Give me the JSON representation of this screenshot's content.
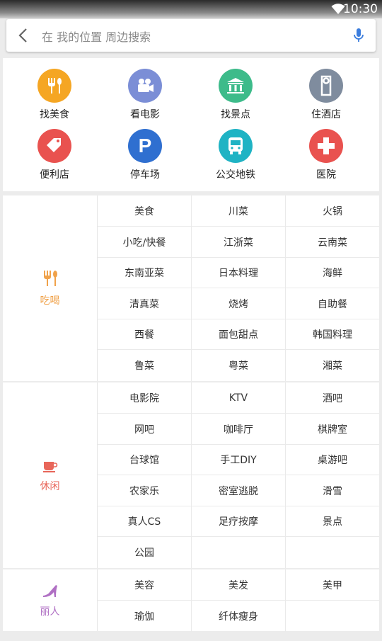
{
  "status": {
    "time": "10:30"
  },
  "search": {
    "placeholder": "在 我的位置 周边搜索"
  },
  "categories": [
    {
      "label": "找美食",
      "icon": "fork-knife-icon",
      "color": "#f5a623"
    },
    {
      "label": "看电影",
      "icon": "movie-camera-icon",
      "color": "#7b8ed6"
    },
    {
      "label": "找景点",
      "icon": "landmark-icon",
      "color": "#3dbb8a"
    },
    {
      "label": "住酒店",
      "icon": "door-tag-icon",
      "color": "#7f8c9e"
    },
    {
      "label": "便利店",
      "icon": "price-tag-icon",
      "color": "#e9524f"
    },
    {
      "label": "停车场",
      "icon": "parking-icon",
      "color": "#2f6fd0"
    },
    {
      "label": "公交地铁",
      "icon": "bus-icon",
      "color": "#1fb3c4"
    },
    {
      "label": "医院",
      "icon": "cross-icon",
      "color": "#e9524f"
    }
  ],
  "sections": [
    {
      "name": "吃喝",
      "icon": "fork-knife-icon",
      "color": "#f0a24a",
      "items": [
        "美食",
        "川菜",
        "火锅",
        "小吃/快餐",
        "江浙菜",
        "云南菜",
        "东南亚菜",
        "日本料理",
        "海鲜",
        "清真菜",
        "烧烤",
        "自助餐",
        "西餐",
        "面包甜点",
        "韩国料理",
        "鲁菜",
        "粤菜",
        "湘菜"
      ]
    },
    {
      "name": "休闲",
      "icon": "cup-icon",
      "color": "#e8665a",
      "items": [
        "电影院",
        "KTV",
        "酒吧",
        "网吧",
        "咖啡厅",
        "棋牌室",
        "台球馆",
        "手工DIY",
        "桌游吧",
        "农家乐",
        "密室逃脱",
        "滑雪",
        "真人CS",
        "足疗按摩",
        "景点",
        "公园",
        "",
        ""
      ]
    },
    {
      "name": "丽人",
      "icon": "high-heel-icon",
      "color": "#b070c4",
      "items": [
        "美容",
        "美发",
        "美甲",
        "瑜伽",
        "纤体瘦身",
        ""
      ]
    }
  ]
}
